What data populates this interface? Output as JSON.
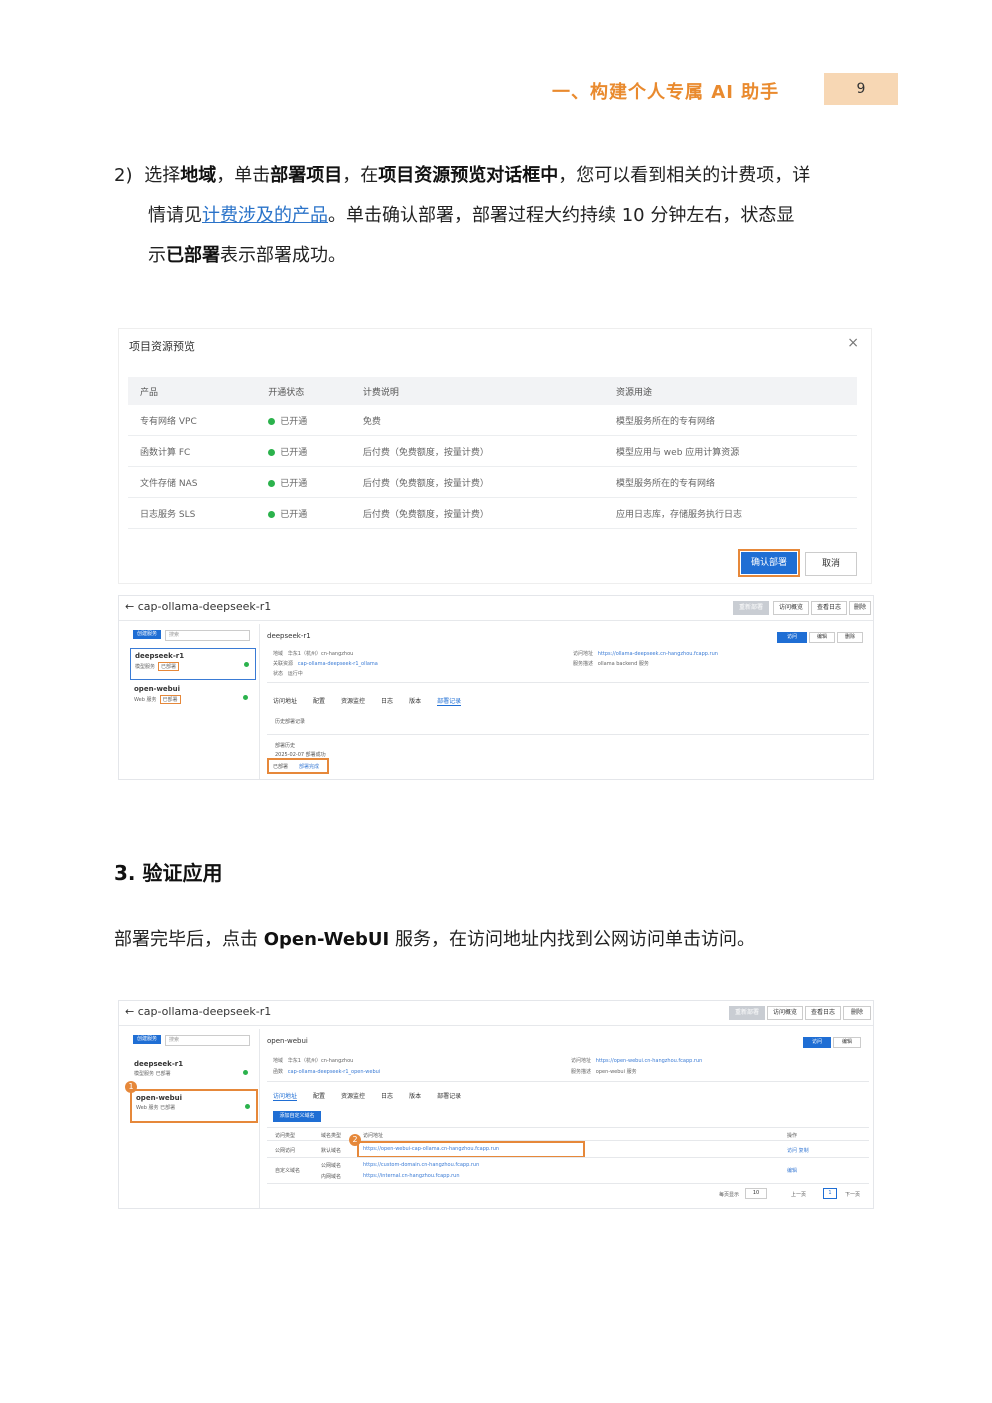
{
  "header": {
    "title": "一、构建个人专属 AI 助手",
    "page_number": "9"
  },
  "step2": {
    "num": "2)",
    "t1": "选择",
    "b1": "地域",
    "t2": "，单击",
    "b2": "部署项目",
    "t3": "，在",
    "b3": "项目资源预览对话框中",
    "t4": "，您可以看到相关的计费项，详",
    "t5": "情请见",
    "link": "计费涉及的产品",
    "t6": "。单击确认部署，部署过程大约持续 10 分钟左右，状态显",
    "t7": "示",
    "b4": "已部署",
    "t8": "表示部署成功。"
  },
  "dialog": {
    "title": "项目资源预览",
    "close": "×",
    "columns": [
      "产品",
      "开通状态",
      "计费说明",
      "资源用途"
    ],
    "rows": [
      {
        "product": "专有网络 VPC",
        "status": "已开通",
        "billing": "免费",
        "usage": "模型服务所在的专有网络"
      },
      {
        "product": "函数计算 FC",
        "status": "已开通",
        "billing": "后付费（免费额度，按量计费）",
        "usage": "模型应用与 web 应用计算资源"
      },
      {
        "product": "文件存储 NAS",
        "status": "已开通",
        "billing": "后付费（免费额度，按量计费）",
        "usage": "模型服务所在的专有网络"
      },
      {
        "product": "日志服务 SLS",
        "status": "已开通",
        "billing": "后付费（免费额度，按量计费）",
        "usage": "应用日志库，存储服务执行日志"
      }
    ],
    "confirm": "确认部署",
    "cancel": "取消"
  },
  "app1": {
    "title": "← cap-ollama-deepseek-r1",
    "top_buttons": [
      "重新部署",
      "访问概览",
      "查看日志",
      "删除"
    ],
    "create_btn": "创建服务",
    "search": "搜索",
    "services": [
      {
        "name": "deepseek-r1",
        "sub": "模型服务",
        "status": "已部署"
      },
      {
        "name": "open-webui",
        "sub": "Web 服务",
        "status": "已部署"
      }
    ],
    "svc_name": "deepseek-r1",
    "region_label": "地域",
    "region_value": "华东1（杭州）cn-hangzhou",
    "func_label": "关联资源",
    "func_value": "cap-ollama-deepseek-r1_ollama",
    "state_label": "状态",
    "state_value": "运行中",
    "addr_label": "访问地址",
    "addr_value": "https://ollama-deepseek.cn-hangzhou.fcapp.run",
    "desc_label": "服务描述",
    "desc_value": "ollama backend 服务",
    "btns": [
      "访问",
      "编辑",
      "删除"
    ],
    "tabs": [
      "访问地址",
      "配置",
      "资源监控",
      "日志",
      "版本",
      "部署记录"
    ],
    "deploy_history": "历史部署记录",
    "deploy_title": "部署历史",
    "deploy_time": "2025-02-07 部署成功",
    "deploy_status": "已部署",
    "deploy_note": "部署完成"
  },
  "step3": {
    "title": "3. 验证应用",
    "t1": "部署完毕后，点击 ",
    "b1": "Open-WebUI",
    "t2": " 服务，在访问地址内找到公网访问单击访问。"
  },
  "app2": {
    "title": "← cap-ollama-deepseek-r1",
    "top_buttons": [
      "重新部署",
      "访问概览",
      "查看日志",
      "删除"
    ],
    "create_btn": "创建服务",
    "search": "搜索",
    "services": [
      {
        "name": "deepseek-r1",
        "sub": "模型服务",
        "status": "已部署"
      },
      {
        "name": "open-webui",
        "sub": "Web 服务",
        "status": "已部署"
      }
    ],
    "svc_name": "open-webui",
    "region_label": "地域",
    "region_value": "华东1（杭州）cn-hangzhou",
    "func_label": "函数",
    "func_value": "cap-ollama-deepseek-r1_open-webui",
    "addr_label": "访问地址",
    "addr_value": "https://open-webui.cn-hangzhou.fcapp.run",
    "desc_label": "服务描述",
    "desc_value": "open-webui 服务",
    "btns": [
      "访问",
      "编辑"
    ],
    "tabs": [
      "访问地址",
      "配置",
      "资源监控",
      "日志",
      "版本",
      "部署记录"
    ],
    "add_btn": "添加自定义域名",
    "table_cols": [
      "访问类型",
      "域名类型",
      "访问地址",
      "操作"
    ],
    "row1": {
      "type": "公网访问",
      "dtype": "默认域名",
      "url": "https://open-webui-cap-ollama.cn-hangzhou.fcapp.run",
      "op": "访问 复制"
    },
    "row2": {
      "type": "自定义域名",
      "dtype": "公网域名",
      "url": "https://custom-domain.cn-hangzhou.fcapp.run",
      "op": "编辑"
    },
    "row3": {
      "dtype": "内网域名",
      "url": "https://internal.cn-hangzhou.fcapp.run"
    },
    "pager": {
      "per_page": "每页显示",
      "size": "10",
      "prev": "上一页",
      "page": "1",
      "next": "下一页"
    },
    "marker1": "1",
    "marker2": "2"
  }
}
